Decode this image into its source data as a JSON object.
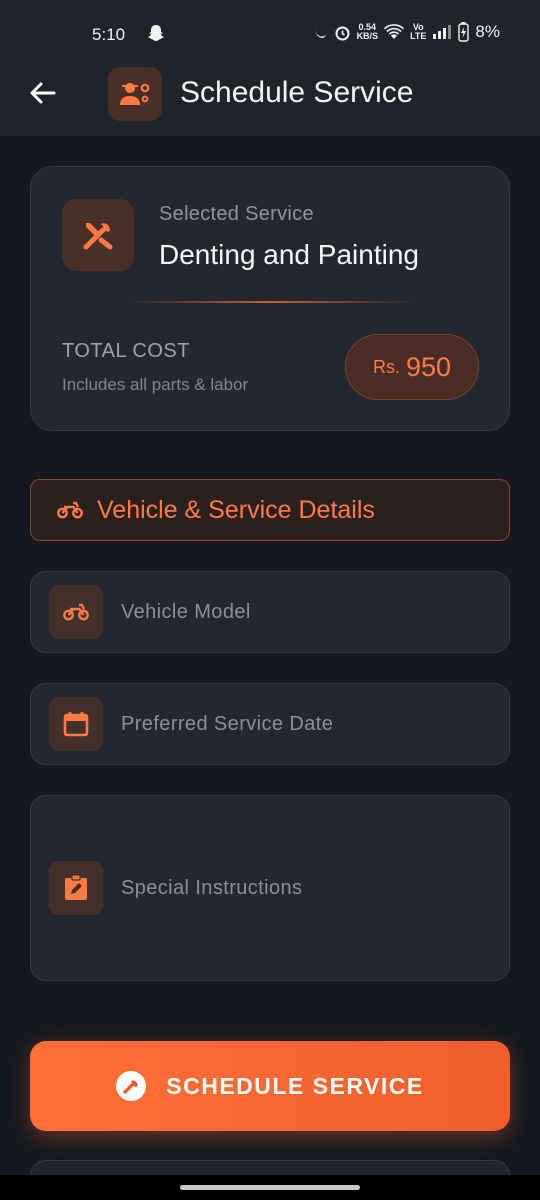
{
  "status": {
    "time": "5:10",
    "net_speed_top": "0.54",
    "net_speed_bottom": "KB/S",
    "volte_top": "Vo",
    "volte_bottom": "LTE",
    "battery": "8%"
  },
  "appbar": {
    "title": "Schedule Service",
    "back_icon": "arrow-left-icon",
    "app_icon": "mechanic-icon"
  },
  "service": {
    "label": "Selected Service",
    "name": "Denting and Painting",
    "icon": "tools-icon",
    "total_cost_label": "TOTAL COST",
    "total_cost_note": "Includes all parts & labor",
    "currency": "Rs.",
    "price": "950"
  },
  "section": {
    "title": "Vehicle & Service Details",
    "icon": "motorcycle-icon"
  },
  "fields": {
    "vehicle_model": {
      "placeholder": "Vehicle Model",
      "icon": "motorcycle-icon"
    },
    "service_date": {
      "placeholder": "Preferred Service Date",
      "icon": "calendar-icon"
    },
    "instructions": {
      "placeholder": "Special Instructions",
      "icon": "clipboard-edit-icon"
    }
  },
  "cta": {
    "label": "SCHEDULE SERVICE",
    "icon": "wrench-icon"
  },
  "colors": {
    "accent": "#ff7a45",
    "background": "#15191f",
    "card": "#232830"
  }
}
